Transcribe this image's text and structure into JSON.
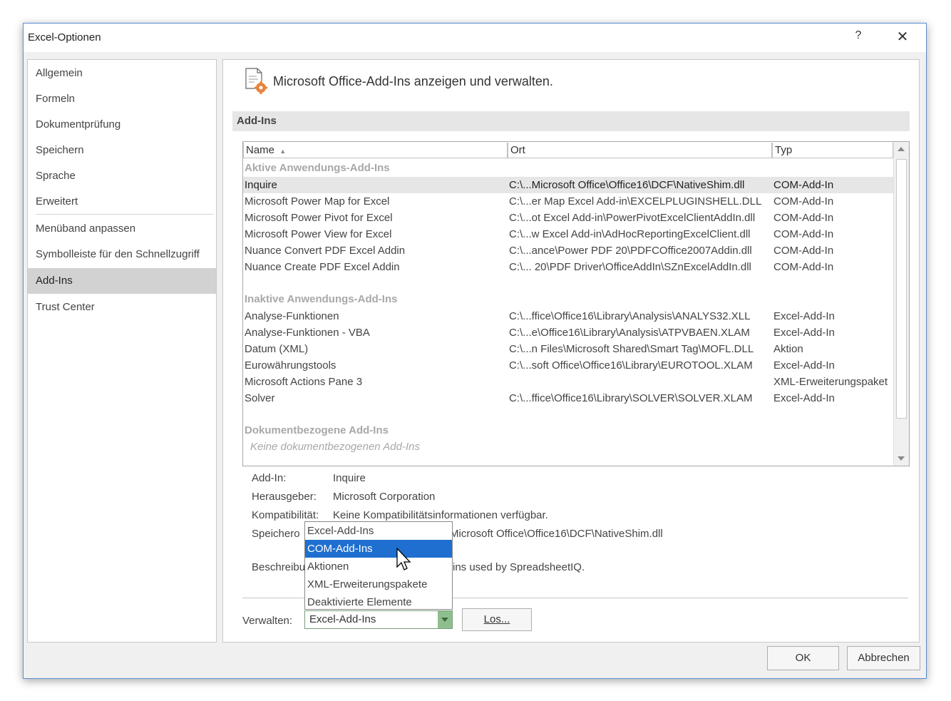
{
  "window": {
    "title": "Excel-Optionen",
    "help_label": "?",
    "close_label": "✕"
  },
  "nav": [
    "Allgemein",
    "Formeln",
    "Dokumentprüfung",
    "Speichern",
    "Sprache",
    "Erweitert",
    "Menüband anpassen",
    "Symbolleiste für den Schnellzugriff",
    "Add-Ins",
    "Trust Center"
  ],
  "nav_active": "Add-Ins",
  "header": {
    "text": "Microsoft Office-Add-Ins anzeigen und verwalten.",
    "icon": "addins-gear-icon"
  },
  "section": "Add-Ins",
  "columns": {
    "name": "Name",
    "sort_indicator": "▲",
    "location": "Ort",
    "type": "Typ"
  },
  "groups": {
    "active": {
      "label": "Aktive Anwendungs-Add-Ins",
      "rows": [
        {
          "name": "Inquire",
          "location": "C:\\...Microsoft Office\\Office16\\DCF\\NativeShim.dll",
          "type": "COM-Add-In",
          "selected": true
        },
        {
          "name": "Microsoft Power Map for Excel",
          "location": "C:\\...er Map Excel Add-in\\EXCELPLUGINSHELL.DLL",
          "type": "COM-Add-In"
        },
        {
          "name": "Microsoft Power Pivot for Excel",
          "location": "C:\\...ot Excel Add-in\\PowerPivotExcelClientAddIn.dll",
          "type": "COM-Add-In"
        },
        {
          "name": "Microsoft Power View for Excel",
          "location": "C:\\...w Excel Add-in\\AdHocReportingExcelClient.dll",
          "type": "COM-Add-In"
        },
        {
          "name": "Nuance Convert PDF Excel Addin",
          "location": "C:\\...ance\\Power PDF 20\\PDFCOffice2007Addin.dll",
          "type": "COM-Add-In"
        },
        {
          "name": "Nuance Create PDF Excel Addin",
          "location": "C:\\... 20\\PDF Driver\\OfficeAddIn\\SZnExcelAddIn.dll",
          "type": "COM-Add-In"
        }
      ]
    },
    "inactive": {
      "label": "Inaktive Anwendungs-Add-Ins",
      "rows": [
        {
          "name": "Analyse-Funktionen",
          "location": "C:\\...ffice\\Office16\\Library\\Analysis\\ANALYS32.XLL",
          "type": "Excel-Add-In"
        },
        {
          "name": "Analyse-Funktionen - VBA",
          "location": "C:\\...e\\Office16\\Library\\Analysis\\ATPVBAEN.XLAM",
          "type": "Excel-Add-In"
        },
        {
          "name": "Datum (XML)",
          "location": "C:\\...n Files\\Microsoft Shared\\Smart Tag\\MOFL.DLL",
          "type": "Aktion"
        },
        {
          "name": "Eurowährungstools",
          "location": "C:\\...soft Office\\Office16\\Library\\EUROTOOL.XLAM",
          "type": "Excel-Add-In"
        },
        {
          "name": "Microsoft Actions Pane 3",
          "location": "",
          "type": "XML-Erweiterungspaket"
        },
        {
          "name": "Solver",
          "location": "C:\\...ffice\\Office16\\Library\\SOLVER\\SOLVER.XLAM",
          "type": "Excel-Add-In"
        }
      ]
    },
    "document": {
      "label": "Dokumentbezogene Add-Ins",
      "empty": "Keine dokumentbezogenen Add-Ins"
    }
  },
  "details": {
    "addin_label": "Add-In:",
    "addin_value": "Inquire",
    "publisher_label": "Herausgeber:",
    "publisher_value": "Microsoft Corporation",
    "compat_label": "Kompatibilität:",
    "compat_value": "Keine Kompatibilitätsinformationen verfügbar.",
    "location_label": "Speichero",
    "location_value": "Microsoft Office\\Office16\\DCF\\NativeShim.dll",
    "desc_label": "Beschreibu",
    "desc_value": "ins used by SpreadsheetIQ."
  },
  "manage": {
    "label": "Verwalten:",
    "selected": "Excel-Add-Ins",
    "go_button": "Los...",
    "options": [
      "Excel-Add-Ins",
      "COM-Add-Ins",
      "Aktionen",
      "XML-Erweiterungspakete",
      "Deaktivierte Elemente"
    ],
    "highlighted": "COM-Add-Ins"
  },
  "buttons": {
    "ok": "OK",
    "cancel": "Abbrechen"
  }
}
